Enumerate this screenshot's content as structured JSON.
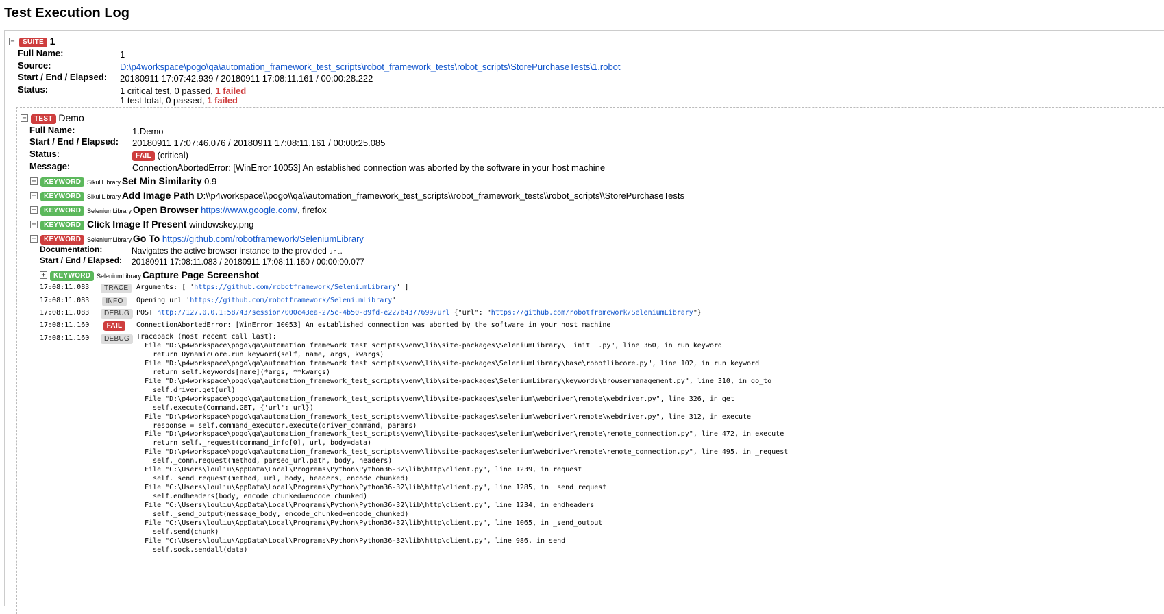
{
  "page": {
    "title": "Test Execution Log"
  },
  "labels": {
    "suite": "SUITE",
    "test": "TEST",
    "keyword": "KEYWORD",
    "full_name": "Full Name:",
    "source": "Source:",
    "start_end_elapsed": "Start / End / Elapsed:",
    "status": "Status:",
    "message": "Message:",
    "documentation": "Documentation:",
    "collapse": "−",
    "expand": "+"
  },
  "suite": {
    "name": "1",
    "full_name": "1",
    "source": "D:\\p4workspace\\pogo\\qa\\automation_framework_test_scripts\\robot_framework_tests\\robot_scripts\\StorePurchaseTests\\1.robot",
    "times": "20180911 17:07:42.939 / 20180911 17:08:11.161 / 00:00:28.222",
    "status_line1_prefix": "1 critical test, 0 passed, ",
    "status_line1_failed": "1 failed",
    "status_line2_prefix": "1 test total, 0 passed, ",
    "status_line2_failed": "1 failed"
  },
  "test": {
    "name": "Demo",
    "full_name": "1.Demo",
    "times": "20180911 17:07:46.076 / 20180911 17:08:11.161 / 00:00:25.085",
    "status_label": "FAIL",
    "status_extra": "(critical)",
    "message": "ConnectionAbortedError: [WinError 10053] An established connection was aborted by the software in your host machine"
  },
  "keywords": [
    {
      "lib": "SikuliLibrary.",
      "name": "Set Min Similarity",
      "args": " 0.9"
    },
    {
      "lib": "SikuliLibrary.",
      "name": "Add Image Path",
      "args": " D:\\\\p4workspace\\\\pogo\\\\qa\\\\automation_framework_test_scripts\\\\robot_framework_tests\\\\robot_scripts\\\\StorePurchaseTests"
    },
    {
      "lib": "SeleniumLibrary.",
      "name": "Open Browser",
      "args_link": "https://www.google.com/",
      "args_rest": ", firefox"
    },
    {
      "lib": "",
      "name": "Click Image If Present",
      "args": " windowskey.png"
    }
  ],
  "goto": {
    "lib": "SeleniumLibrary.",
    "name": "Go To",
    "arg_link": "https://github.com/robotframework/SeleniumLibrary",
    "doc_prefix": "Navigates the active browser instance to the provided ",
    "doc_code": "url",
    "doc_suffix": ".",
    "times": "20180911 17:08:11.083 / 20180911 17:08:11.160 / 00:00:00.077",
    "sub_lib": "SeleniumLibrary.",
    "sub_name": "Capture Page Screenshot"
  },
  "log": [
    {
      "time": "17:08:11.083",
      "level": "TRACE",
      "pre": "Arguments: [ '",
      "link": "https://github.com/robotframework/SeleniumLibrary",
      "post": "' ]"
    },
    {
      "time": "17:08:11.083",
      "level": "INFO",
      "pre": "Opening url '",
      "link": "https://github.com/robotframework/SeleniumLibrary",
      "post": "'"
    },
    {
      "time": "17:08:11.083",
      "level": "DEBUG",
      "pre": "POST ",
      "link": "http://127.0.0.1:58743/session/000c43ea-275c-4b50-89fd-e227b4377699/url",
      "mid": " {\"url\": \"",
      "link2": "https://github.com/robotframework/SeleniumLibrary",
      "post": "\"}"
    },
    {
      "time": "17:08:11.160",
      "level": "FAIL",
      "pre": "ConnectionAbortedError: [WinError 10053] An established connection was aborted by the software in your host machine"
    },
    {
      "time": "17:08:11.160",
      "level": "DEBUG",
      "pre": ""
    }
  ],
  "traceback": [
    "Traceback (most recent call last):",
    "  File \"D:\\p4workspace\\pogo\\qa\\automation_framework_test_scripts\\venv\\lib\\site-packages\\SeleniumLibrary\\__init__.py\", line 360, in run_keyword",
    "    return DynamicCore.run_keyword(self, name, args, kwargs)",
    "  File \"D:\\p4workspace\\pogo\\qa\\automation_framework_test_scripts\\venv\\lib\\site-packages\\SeleniumLibrary\\base\\robotlibcore.py\", line 102, in run_keyword",
    "    return self.keywords[name](*args, **kwargs)",
    "  File \"D:\\p4workspace\\pogo\\qa\\automation_framework_test_scripts\\venv\\lib\\site-packages\\SeleniumLibrary\\keywords\\browsermanagement.py\", line 310, in go_to",
    "    self.driver.get(url)",
    "  File \"D:\\p4workspace\\pogo\\qa\\automation_framework_test_scripts\\venv\\lib\\site-packages\\selenium\\webdriver\\remote\\webdriver.py\", line 326, in get",
    "    self.execute(Command.GET, {'url': url})",
    "  File \"D:\\p4workspace\\pogo\\qa\\automation_framework_test_scripts\\venv\\lib\\site-packages\\selenium\\webdriver\\remote\\webdriver.py\", line 312, in execute",
    "    response = self.command_executor.execute(driver_command, params)",
    "  File \"D:\\p4workspace\\pogo\\qa\\automation_framework_test_scripts\\venv\\lib\\site-packages\\selenium\\webdriver\\remote\\remote_connection.py\", line 472, in execute",
    "    return self._request(command_info[0], url, body=data)",
    "  File \"D:\\p4workspace\\pogo\\qa\\automation_framework_test_scripts\\venv\\lib\\site-packages\\selenium\\webdriver\\remote\\remote_connection.py\", line 495, in _request",
    "    self._conn.request(method, parsed_url.path, body, headers)",
    "  File \"C:\\Users\\louliu\\AppData\\Local\\Programs\\Python\\Python36-32\\lib\\http\\client.py\", line 1239, in request",
    "    self._send_request(method, url, body, headers, encode_chunked)",
    "  File \"C:\\Users\\louliu\\AppData\\Local\\Programs\\Python\\Python36-32\\lib\\http\\client.py\", line 1285, in _send_request",
    "    self.endheaders(body, encode_chunked=encode_chunked)",
    "  File \"C:\\Users\\louliu\\AppData\\Local\\Programs\\Python\\Python36-32\\lib\\http\\client.py\", line 1234, in endheaders",
    "    self._send_output(message_body, encode_chunked=encode_chunked)",
    "  File \"C:\\Users\\louliu\\AppData\\Local\\Programs\\Python\\Python36-32\\lib\\http\\client.py\", line 1065, in _send_output",
    "    self.send(chunk)",
    "  File \"C:\\Users\\louliu\\AppData\\Local\\Programs\\Python\\Python36-32\\lib\\http\\client.py\", line 986, in send",
    "    self.sock.sendall(data)"
  ]
}
